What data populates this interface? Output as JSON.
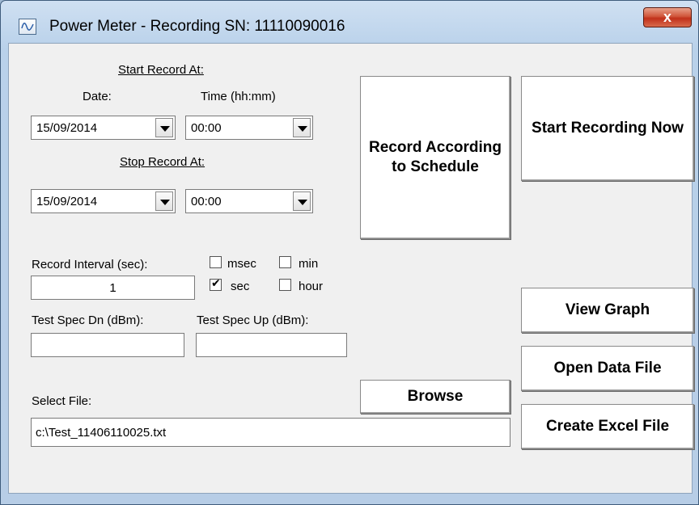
{
  "window": {
    "title": "Power Meter - Recording SN: 11110090016",
    "close_label": "x"
  },
  "schedule": {
    "start_heading": "Start Record At:",
    "date_label": "Date:",
    "time_label": "Time (hh:mm)",
    "start_date": "15/09/2014",
    "start_time": "00:00",
    "stop_heading": "Stop Record At:",
    "stop_date": "15/09/2014",
    "stop_time": "00:00"
  },
  "buttons": {
    "record_schedule": "Record According to Schedule",
    "start_now": "Start Recording Now",
    "view_graph": "View Graph",
    "open_data": "Open Data File",
    "create_excel": "Create Excel File",
    "browse": "Browse"
  },
  "interval": {
    "label": "Record Interval (sec):",
    "value": "1",
    "units": [
      {
        "label": "msec",
        "checked": false
      },
      {
        "label": "min",
        "checked": false
      },
      {
        "label": "sec",
        "checked": true
      },
      {
        "label": "hour",
        "checked": false
      }
    ]
  },
  "spec": {
    "dn_label": "Test Spec Dn (dBm):",
    "up_label": "Test Spec Up (dBm):",
    "dn_value": "",
    "up_value": ""
  },
  "file": {
    "label": "Select File:",
    "value": "c:\\Test_11406110025.txt"
  }
}
